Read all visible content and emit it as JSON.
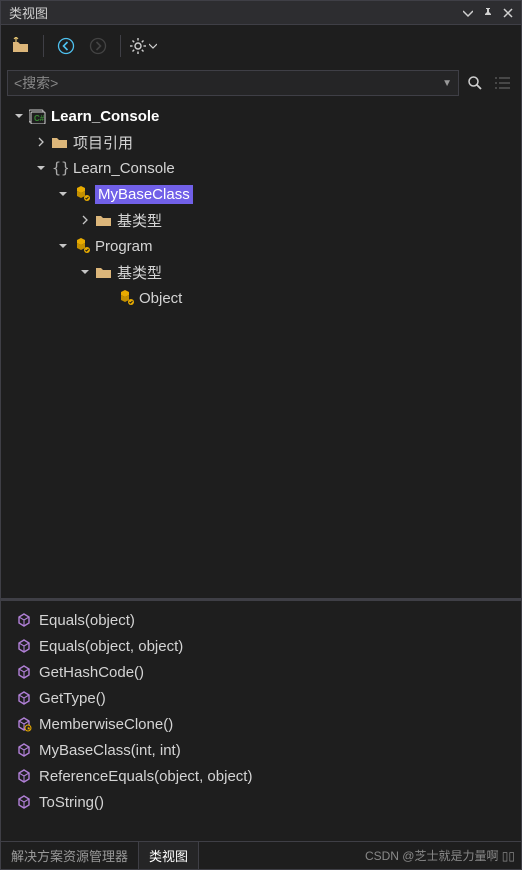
{
  "title": "类视图",
  "toolbar": {
    "new_folder": "new-folder",
    "back": "back",
    "forward": "forward",
    "settings": "settings"
  },
  "search": {
    "placeholder": "<搜索>"
  },
  "tree": [
    {
      "depth": 0,
      "expand": "down",
      "icon": "csharp-project",
      "label": "Learn_Console",
      "bold": true
    },
    {
      "depth": 1,
      "expand": "right",
      "icon": "folder",
      "label": "项目引用"
    },
    {
      "depth": 1,
      "expand": "down",
      "icon": "namespace",
      "label": "Learn_Console"
    },
    {
      "depth": 2,
      "expand": "down",
      "icon": "class",
      "label": "MyBaseClass",
      "selected": true
    },
    {
      "depth": 3,
      "expand": "right",
      "icon": "folder",
      "label": "基类型"
    },
    {
      "depth": 2,
      "expand": "down",
      "icon": "class",
      "label": "Program"
    },
    {
      "depth": 3,
      "expand": "down",
      "icon": "folder",
      "label": "基类型"
    },
    {
      "depth": 4,
      "expand": "none",
      "icon": "class",
      "label": "Object"
    }
  ],
  "members": [
    {
      "icon": "method",
      "label": "Equals(object)"
    },
    {
      "icon": "method",
      "label": "Equals(object, object)"
    },
    {
      "icon": "method",
      "label": "GetHashCode()"
    },
    {
      "icon": "method",
      "label": "GetType()"
    },
    {
      "icon": "method-protected",
      "label": "MemberwiseClone()"
    },
    {
      "icon": "method",
      "label": "MyBaseClass(int, int)"
    },
    {
      "icon": "method",
      "label": "ReferenceEquals(object, object)"
    },
    {
      "icon": "method",
      "label": "ToString()"
    }
  ],
  "footer": {
    "tabs": [
      {
        "label": "解决方案资源管理器",
        "active": false
      },
      {
        "label": "类视图",
        "active": true
      }
    ],
    "watermark": "CSDN @芝士就是力量啊 ▯▯"
  }
}
